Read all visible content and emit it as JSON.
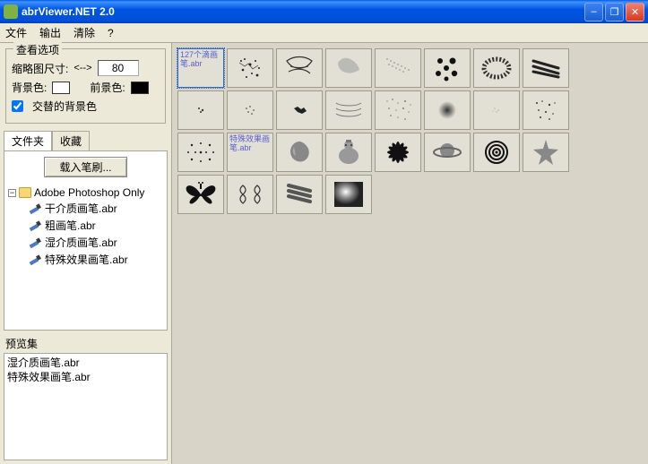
{
  "window": {
    "title": "abrViewer.NET 2.0"
  },
  "menu": {
    "file": "文件",
    "export": "输出",
    "clear": "清除",
    "help": "?"
  },
  "options": {
    "legend": "查看选项",
    "thumb_size_label": "缩略图尺寸:",
    "thumb_size_value": "80",
    "bg_label": "背景色:",
    "fg_label": "前景色:",
    "alt_bg_label": "交替的背景色"
  },
  "tabs": {
    "folders": "文件夹",
    "favorites": "收藏"
  },
  "load_btn": "载入笔刷...",
  "tree": {
    "root": "Adobe Photoshop Only",
    "items": [
      "干介质画笔.abr",
      "粗画笔.abr",
      "湿介质画笔.abr",
      "特殊效果画笔.abr"
    ]
  },
  "preset": {
    "label": "预览集",
    "lines": [
      "湿介质画笔.abr",
      "特殊效果画笔.abr"
    ]
  },
  "thumbs_label1": {
    "line1": "127个滴画",
    "line2": "笔.abr"
  },
  "thumbs_label2": {
    "line1": "特殊效果画",
    "line2": "笔.abr"
  },
  "icons": {
    "minimize": "–",
    "maximize": "❐",
    "close": "✕",
    "collapse": "−",
    "arrows": "<-->"
  }
}
